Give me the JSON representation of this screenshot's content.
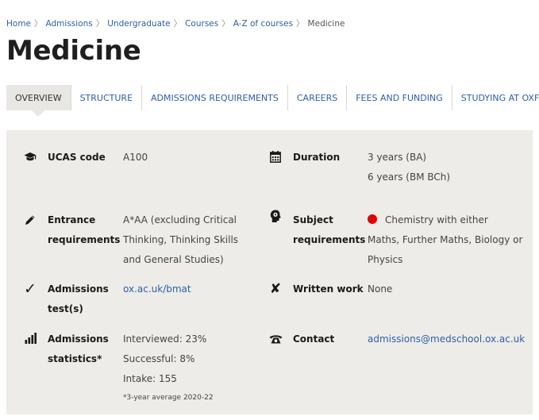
{
  "breadcrumb": [
    {
      "label": "Home"
    },
    {
      "label": "Admissions"
    },
    {
      "label": "Undergraduate"
    },
    {
      "label": "Courses"
    },
    {
      "label": "A-Z of courses"
    },
    {
      "label": "Medicine"
    }
  ],
  "page_title": "Medicine",
  "tabs": [
    {
      "label": "OVERVIEW",
      "active": true
    },
    {
      "label": "STRUCTURE"
    },
    {
      "label": "ADMISSIONS REQUIREMENTS"
    },
    {
      "label": "CAREERS"
    },
    {
      "label": "FEES AND FUNDING"
    },
    {
      "label": "STUDYING AT OXFORD"
    }
  ],
  "colors": {
    "accent": "#2e5fa8",
    "panel_bg": "#edece8",
    "required_dot": "#e00000"
  },
  "facts": {
    "ucas": {
      "icon": "graduation-cap-icon",
      "label": "UCAS code",
      "value": "A100"
    },
    "duration": {
      "icon": "calendar-icon",
      "label": "Duration",
      "value1": "3 years (BA)",
      "value2": "6 years (BM BCh)"
    },
    "entrance": {
      "icon": "pencil-icon",
      "label1": "Entrance",
      "label2": "requirements",
      "v1": "A*AA (excluding Critical",
      "v2": "Thinking, Thinking Skills",
      "v3": "and General Studies)"
    },
    "subject": {
      "icon": "head-icon",
      "label1": "Subject",
      "label2": "requirements",
      "v1": "Chemistry with either",
      "v2": "Maths, Further Maths, Biology or",
      "v3": "Physics"
    },
    "test": {
      "icon": "check-icon",
      "label1": "Admissions",
      "label2": "test(s)",
      "link": "ox.ac.uk/bmat"
    },
    "written": {
      "icon": "cross-icon",
      "label": "Written work",
      "value": "None"
    },
    "stats": {
      "icon": "bar-chart-icon",
      "label1": "Admissions",
      "label2": "statistics*",
      "v1": "Interviewed: 23%",
      "v2": "Successful: 8%",
      "v3": "Intake: 155",
      "note": "*3-year average 2020-22"
    },
    "contact": {
      "icon": "phone-icon",
      "label": "Contact",
      "link": "admissions@medschool.ox.ac.uk"
    }
  }
}
